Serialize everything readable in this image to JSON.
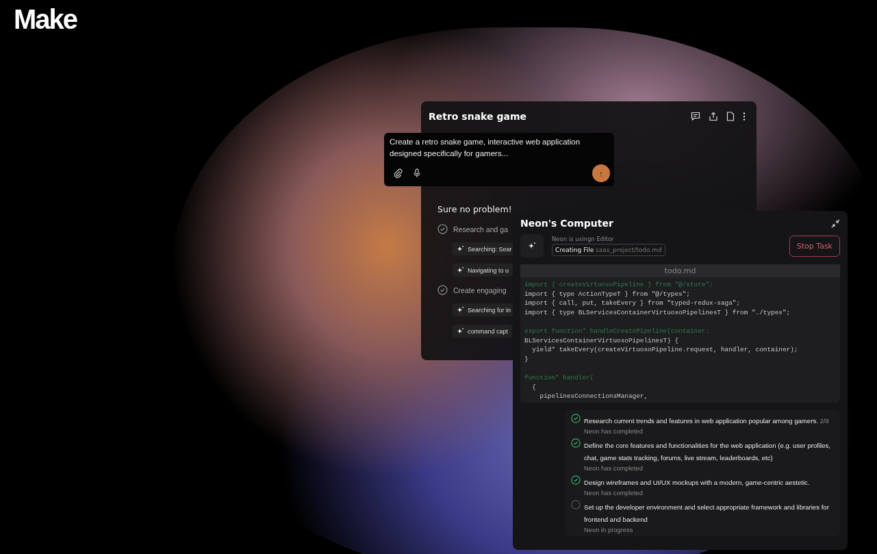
{
  "brand": {
    "logo": "Make"
  },
  "chat_card": {
    "title": "Retro snake game",
    "reply": "Sure no problem!",
    "steps": [
      {
        "text": "Research and ga",
        "done": true,
        "actions": [
          "Searching: Sear",
          "Navigating to u"
        ]
      },
      {
        "text": "Create engaging",
        "done": true,
        "actions": [
          "Searching for in",
          "command capt"
        ]
      }
    ]
  },
  "prompt": {
    "value": "Create a retro snake game, interactive web application designed specifically for gamers...",
    "send_label": "↑"
  },
  "computer": {
    "title": "Neon's Computer",
    "tool_label": "Neon is usingn Editor",
    "action": "Creating File",
    "path": "saas_project/todo.md",
    "stop_button": "Stop Task",
    "file": {
      "name": "todo.md",
      "lines": [
        {
          "kind": "green",
          "text": "import { createVirtuosoPipeline } from \"@/store\";"
        },
        {
          "kind": "plain",
          "text": "import { type ActionTypeT } from \"@/types\";"
        },
        {
          "kind": "plain",
          "text": "import { call, put, takeEvery } from \"typed-redux-saga\";"
        },
        {
          "kind": "plain",
          "text": "import { type BLServicesContainerVirtuosoPipelinesT } from \"./types\";"
        },
        {
          "kind": "blank"
        },
        {
          "kind": "green",
          "text": "export function* handleCreatePipeline(container:"
        },
        {
          "kind": "plain",
          "text": "BLServicesContainerVirtuosoPipelinesT) {"
        },
        {
          "kind": "plain",
          "text": "  yield* takeEvery(createVirtuosoPipeline.request, handler, container);"
        },
        {
          "kind": "plain",
          "text": "}"
        },
        {
          "kind": "blank"
        },
        {
          "kind": "green",
          "text": "function* handler("
        },
        {
          "kind": "plain",
          "text": "  {"
        },
        {
          "kind": "plain",
          "text": "    pipelinesConnectionsManager,"
        }
      ]
    },
    "tasks": [
      {
        "text": "Research current trends and features in web application popular among gamers.",
        "count": "2/8",
        "status": "Neon has completed",
        "done": true
      },
      {
        "text": "Define the core features and functionalities for the web application (e.g. user profiles, chat, game stats tracking, forums, live stream, leaderboards, etc)",
        "status": "Neon has completed",
        "done": true
      },
      {
        "text": "Design wireframes and UI/UX mockups with a modern, game-centric aestetic.",
        "status": "Neon has completed",
        "done": true
      },
      {
        "text": "Set up the developer environment and select appropriate framework and libraries for frontend and backend",
        "status": "Neon in progress",
        "done": false
      }
    ]
  }
}
